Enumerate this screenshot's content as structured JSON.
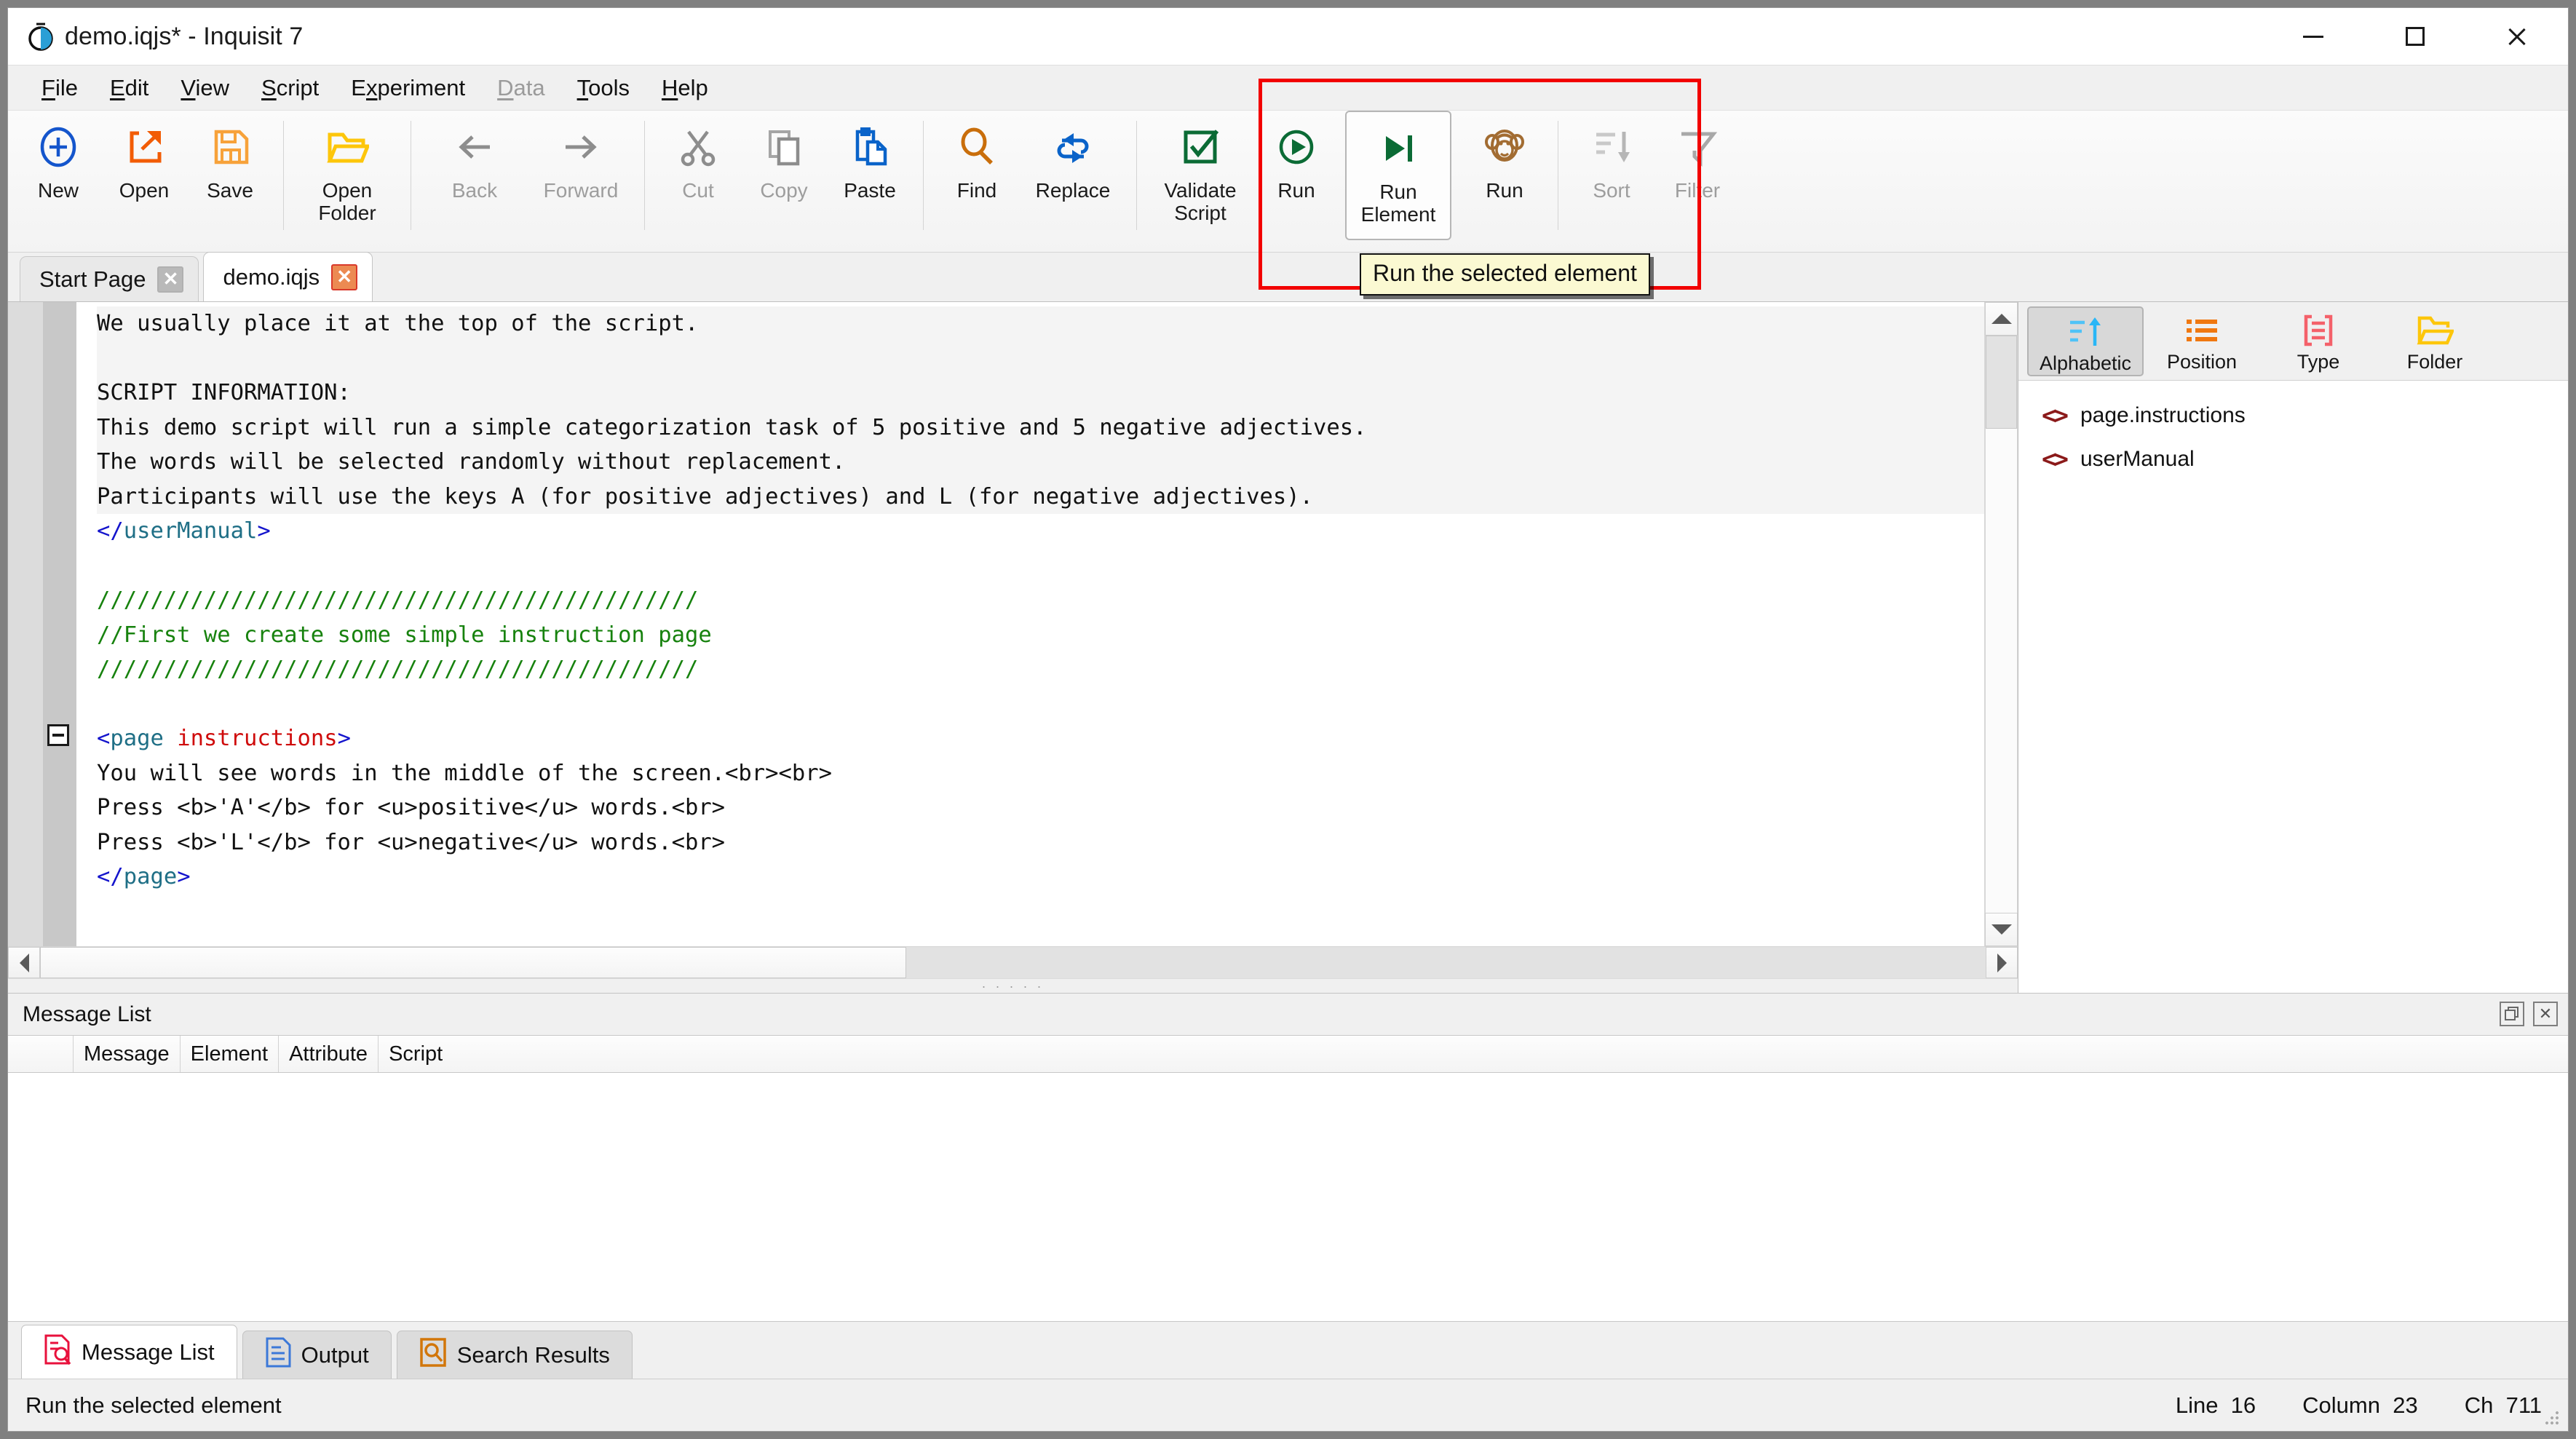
{
  "window": {
    "title": "demo.iqjs* - Inquisit 7",
    "logo_icon": "stopwatch-icon",
    "controls": {
      "minimize": "minimize-icon",
      "maximize": "maximize-icon",
      "close": "close-icon"
    }
  },
  "menubar": {
    "items": [
      {
        "label": "File",
        "accel": "F",
        "disabled": false
      },
      {
        "label": "Edit",
        "accel": "E",
        "disabled": false
      },
      {
        "label": "View",
        "accel": "V",
        "disabled": false
      },
      {
        "label": "Script",
        "accel": "S",
        "disabled": false
      },
      {
        "label": "Experiment",
        "accel": "x",
        "disabled": false
      },
      {
        "label": "Data",
        "accel": "D",
        "disabled": true
      },
      {
        "label": "Tools",
        "accel": "T",
        "disabled": false
      },
      {
        "label": "Help",
        "accel": "H",
        "disabled": false
      }
    ]
  },
  "toolbar": {
    "buttons": [
      {
        "label": "New",
        "icon": "plus-circle-icon",
        "disabled": false
      },
      {
        "label": "Open",
        "icon": "open-arrow-icon",
        "disabled": false
      },
      {
        "label": "Save",
        "icon": "floppy-disk-icon",
        "disabled": false
      },
      {
        "label": "Open\nFolder",
        "icon": "folder-open-icon",
        "disabled": false
      },
      {
        "label": "Back",
        "icon": "arrow-left-icon",
        "disabled": true
      },
      {
        "label": "Forward",
        "icon": "arrow-right-icon",
        "disabled": true
      },
      {
        "label": "Cut",
        "icon": "scissors-icon",
        "disabled": true
      },
      {
        "label": "Copy",
        "icon": "copy-icon",
        "disabled": true
      },
      {
        "label": "Paste",
        "icon": "paste-icon",
        "disabled": false
      },
      {
        "label": "Find",
        "icon": "magnifier-icon",
        "disabled": false
      },
      {
        "label": "Replace",
        "icon": "replace-arrows-icon",
        "disabled": false
      },
      {
        "label": "Validate\nScript",
        "icon": "check-square-icon",
        "disabled": false
      },
      {
        "label": "Run",
        "icon": "play-circle-icon",
        "disabled": false
      },
      {
        "label": "Run\nElement",
        "icon": "play-to-end-icon",
        "disabled": false,
        "selected": true
      },
      {
        "label": "Run",
        "icon": "monkey-icon",
        "disabled": false
      },
      {
        "label": "Sort",
        "icon": "sort-descending-icon",
        "disabled": true
      },
      {
        "label": "Filter",
        "icon": "funnel-icon",
        "disabled": true
      }
    ],
    "tooltip": "Run the selected element",
    "highlight_color": "#f20000"
  },
  "doctabs": [
    {
      "label": "Start Page",
      "active": false,
      "close_icon": "close-icon"
    },
    {
      "label": "demo.iqjs",
      "active": true,
      "close_icon": "close-icon"
    }
  ],
  "editor": {
    "lines": [
      {
        "selected": true,
        "tokens": [
          {
            "t": "We usually place it at the top of the script.",
            "c": "plain"
          }
        ]
      },
      {
        "selected": true,
        "tokens": [
          {
            "t": "",
            "c": "plain"
          }
        ]
      },
      {
        "selected": true,
        "tokens": [
          {
            "t": "SCRIPT INFORMATION:",
            "c": "plain"
          }
        ]
      },
      {
        "selected": true,
        "tokens": [
          {
            "t": "This demo script will run a simple categorization task of 5 positive and 5 negative adjectives.",
            "c": "plain"
          }
        ]
      },
      {
        "selected": true,
        "tokens": [
          {
            "t": "The words will be selected randomly without replacement.",
            "c": "plain"
          }
        ]
      },
      {
        "selected": true,
        "tokens": [
          {
            "t": "Participants will use the keys A (for positive adjectives) and L (for negative adjectives).",
            "c": "plain"
          }
        ]
      },
      {
        "selected": false,
        "tokens": [
          {
            "t": "</",
            "c": "brk"
          },
          {
            "t": "userManual",
            "c": "tag"
          },
          {
            "t": ">",
            "c": "brk"
          }
        ]
      },
      {
        "selected": false,
        "tokens": [
          {
            "t": "",
            "c": "plain"
          }
        ]
      },
      {
        "selected": false,
        "tokens": [
          {
            "t": "/////////////////////////////////////////////",
            "c": "comment"
          }
        ]
      },
      {
        "selected": false,
        "tokens": [
          {
            "t": "//First we create some simple instruction page",
            "c": "comment"
          }
        ]
      },
      {
        "selected": false,
        "tokens": [
          {
            "t": "/////////////////////////////////////////////",
            "c": "comment"
          }
        ]
      },
      {
        "selected": false,
        "tokens": [
          {
            "t": "",
            "c": "plain"
          }
        ]
      },
      {
        "selected": false,
        "fold": true,
        "tokens": [
          {
            "t": "<",
            "c": "brk"
          },
          {
            "t": "page ",
            "c": "tag"
          },
          {
            "t": "instructions",
            "c": "attr"
          },
          {
            "t": ">",
            "c": "brk"
          }
        ]
      },
      {
        "selected": false,
        "tokens": [
          {
            "t": "You will see words in the middle of the screen.<br><br>",
            "c": "plain"
          }
        ]
      },
      {
        "selected": false,
        "tokens": [
          {
            "t": "Press <b>'A'</b> for <u>positive</u> words.<br>",
            "c": "plain"
          }
        ]
      },
      {
        "selected": false,
        "tokens": [
          {
            "t": "Press <b>'L'</b> for <u>negative</u> words.<br>",
            "c": "plain"
          }
        ]
      },
      {
        "selected": false,
        "tokens": [
          {
            "t": "</",
            "c": "brk"
          },
          {
            "t": "page",
            "c": "tag"
          },
          {
            "t": ">",
            "c": "brk"
          }
        ]
      }
    ]
  },
  "elements_panel": {
    "sort_buttons": [
      {
        "label": "Alphabetic",
        "icon": "sort-alpha-up-icon",
        "active": true
      },
      {
        "label": "Position",
        "icon": "bullet-list-icon",
        "active": false
      },
      {
        "label": "Type",
        "icon": "type-brackets-icon",
        "active": false
      },
      {
        "label": "Folder",
        "icon": "folder-open-icon",
        "active": false
      }
    ],
    "items": [
      {
        "label": "page.instructions",
        "icon": "code-brackets-icon"
      },
      {
        "label": "userManual",
        "icon": "code-brackets-icon"
      }
    ]
  },
  "message_dock": {
    "title": "Message List",
    "float_icon": "float-window-icon",
    "close_icon": "close-icon",
    "columns": [
      "Message",
      "Element",
      "Attribute",
      "Script"
    ],
    "rows": []
  },
  "bottom_tabs": [
    {
      "label": "Message List",
      "icon": "message-list-icon",
      "active": true
    },
    {
      "label": "Output",
      "icon": "document-icon",
      "active": false
    },
    {
      "label": "Search Results",
      "icon": "search-results-icon",
      "active": false
    }
  ],
  "statusbar": {
    "message": "Run the selected element",
    "line_label": "Line",
    "line_value": "16",
    "column_label": "Column",
    "column_value": "23",
    "ch_label": "Ch",
    "ch_value": "711"
  }
}
